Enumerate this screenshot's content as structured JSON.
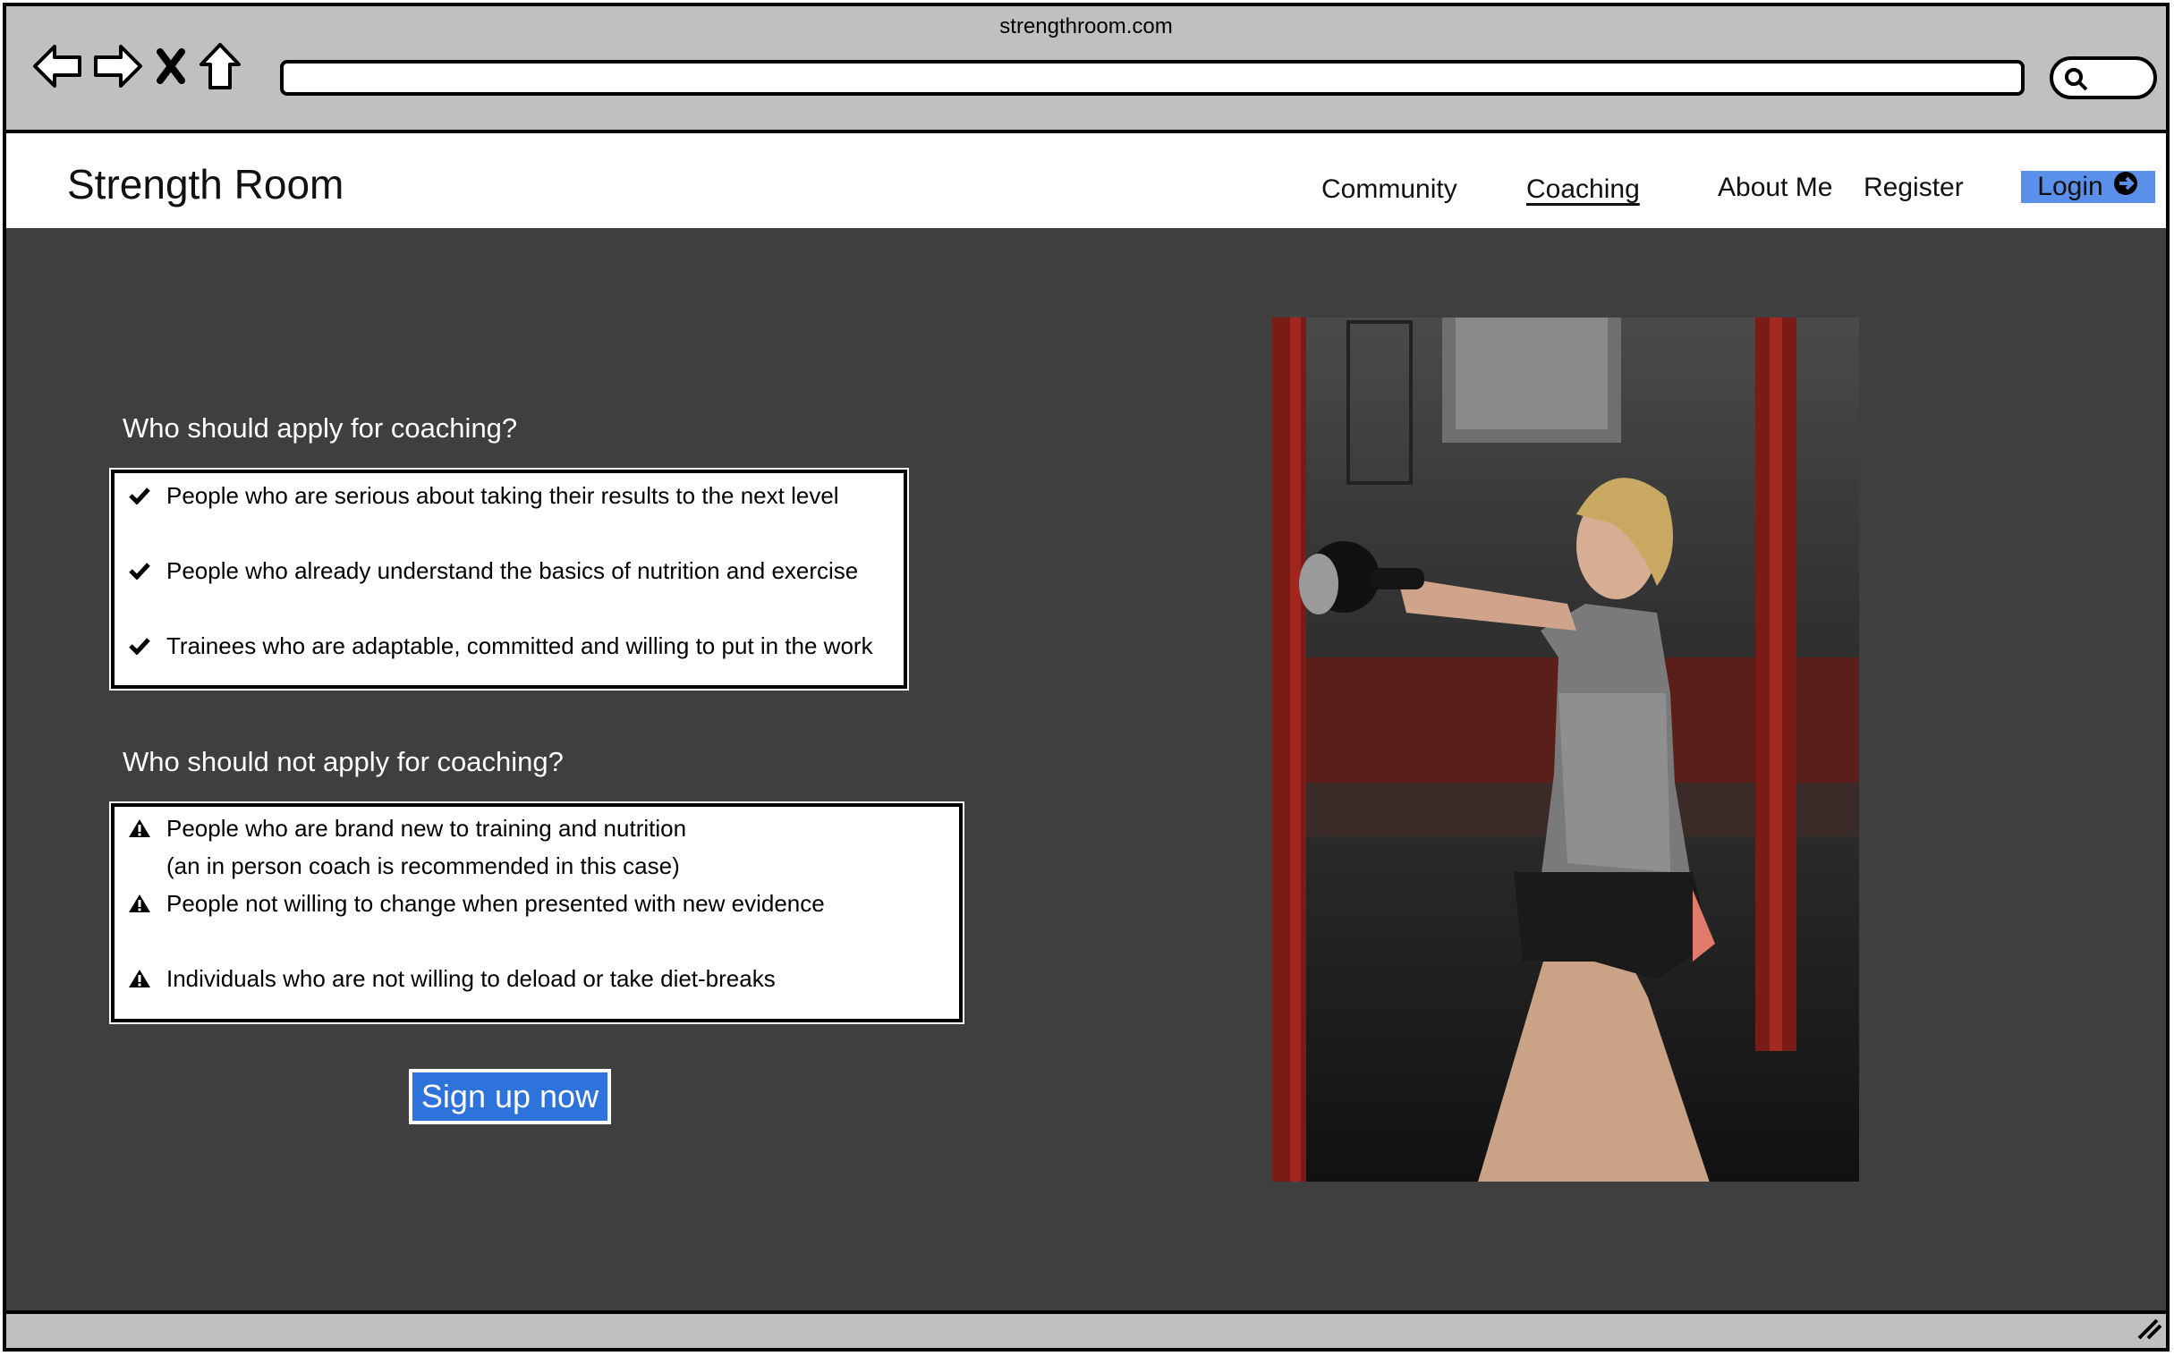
{
  "browser": {
    "url": "strengthroom.com",
    "icons": [
      "back-arrow-icon",
      "forward-arrow-icon",
      "close-icon",
      "home-icon",
      "search-icon"
    ]
  },
  "header": {
    "brand": "Strength Room",
    "nav": [
      "Community",
      "Coaching",
      "About Me",
      "Register"
    ],
    "active_nav": "Coaching",
    "login_label": "Login"
  },
  "apply": {
    "heading": "Who should apply for coaching?",
    "items": [
      "People who are serious about taking their results to the next level",
      "People who already understand the basics of nutrition and exercise",
      "Trainees who are adaptable, committed and willing to put in the work"
    ]
  },
  "not_apply": {
    "heading": "Who should not apply for coaching?",
    "items": [
      "People who are brand new to training and nutrition",
      "(an in person coach is recommended in this case)",
      "People not willing to change when presented with new evidence",
      "Individuals who are not willing to deload or take diet-breaks"
    ]
  },
  "cta": {
    "label": "Sign up now"
  },
  "colors": {
    "accent": "#2e72db",
    "login_bg": "#5a8fea",
    "page_bg": "#3f3f3f",
    "chrome": "#c0c0c0"
  }
}
